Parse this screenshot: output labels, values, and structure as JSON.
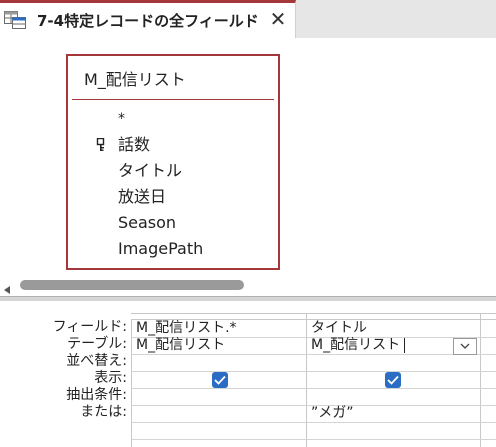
{
  "tab": {
    "title": "7-4特定レコードの全フィールド",
    "close_glyph": "✕",
    "icon": "query-icon"
  },
  "field_list": {
    "title": "M_配信リスト",
    "items": [
      {
        "label": "*",
        "primary_key": false
      },
      {
        "label": "話数",
        "primary_key": true
      },
      {
        "label": "タイトル",
        "primary_key": false
      },
      {
        "label": "放送日",
        "primary_key": false
      },
      {
        "label": "Season",
        "primary_key": false
      },
      {
        "label": "ImagePath",
        "primary_key": false
      }
    ]
  },
  "grid": {
    "row_labels": {
      "field": "フィールド:",
      "table": "テーブル:",
      "sort": "並べ替え:",
      "show": "表示:",
      "criteria": "抽出条件:",
      "or": "または:"
    },
    "columns": [
      {
        "field": "M_配信リスト.*",
        "table": "M_配信リスト",
        "sort": "",
        "show": true,
        "criteria": "",
        "or": ""
      },
      {
        "field": "タイトル",
        "table": "M_配信リスト",
        "sort": "",
        "show": true,
        "criteria": "”メガ”",
        "or": ""
      }
    ]
  },
  "colors": {
    "accent": "#a4373a",
    "checkbox": "#2b6cc4"
  }
}
